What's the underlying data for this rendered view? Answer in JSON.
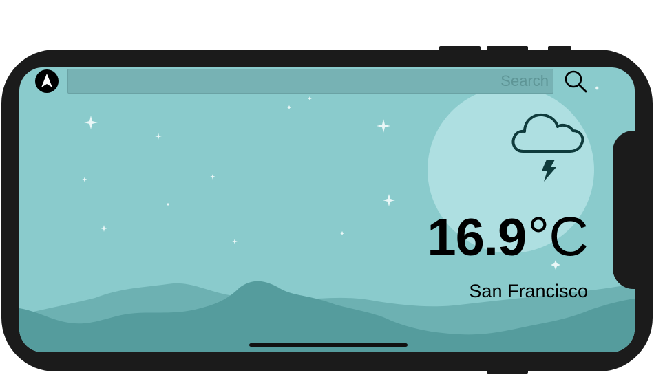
{
  "search": {
    "placeholder": "Search"
  },
  "weather": {
    "temperature": "16.9",
    "unit": "°C",
    "condition_icon": "cloud-lightning-icon",
    "city": "San Francisco"
  },
  "icons": {
    "location": "location-arrow-icon",
    "search": "search-icon"
  },
  "colors": {
    "sky": "#8acbcc",
    "hill_back": "#6db1b2",
    "hill_front": "#559c9d",
    "moon": "#aedfe1",
    "icon_stroke": "#0f3b3c"
  }
}
